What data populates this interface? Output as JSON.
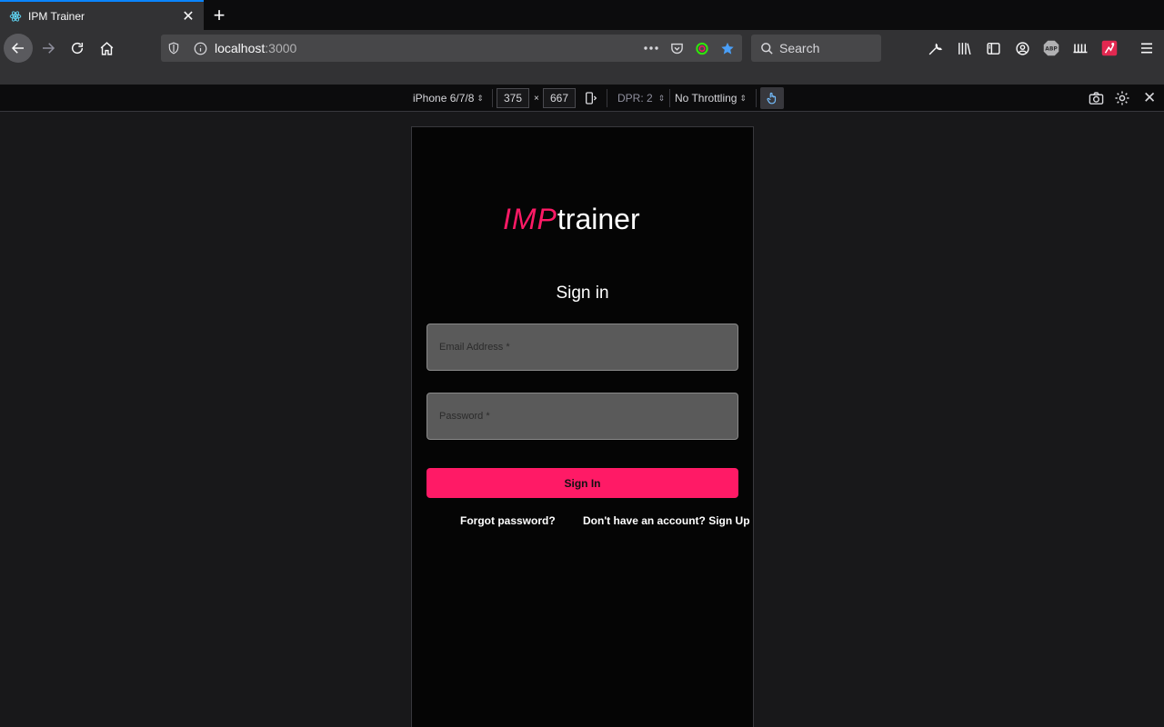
{
  "tab": {
    "title": "IPM Trainer"
  },
  "navbar": {
    "url_host": "localhost",
    "url_port": ":3000",
    "search_placeholder": "Search"
  },
  "rdm": {
    "device": "iPhone 6/7/8",
    "width": "375",
    "times": "×",
    "height": "667",
    "dpr": "DPR: 2",
    "throttling": "No Throttling"
  },
  "app": {
    "logo_part1": "IMP",
    "logo_part2": "trainer",
    "title": "Sign in",
    "email_placeholder": "Email Address *",
    "password_placeholder": "Password *",
    "signin_label": "Sign In",
    "forgot_label": "Forgot password?",
    "signup_label": "Don't have an account? Sign Up"
  },
  "colors": {
    "accent": "#ff1a66",
    "browser_highlight": "#0a84ff"
  },
  "icons": [
    "react-icon",
    "close-icon",
    "plus-icon",
    "back-icon",
    "forward-icon",
    "reload-icon",
    "home-icon",
    "shield-icon",
    "info-icon",
    "more-icon",
    "pocket-icon",
    "extension-icon",
    "bookmark-star-icon",
    "search-icon",
    "wrench-icon",
    "library-icon",
    "sidebar-icon",
    "account-icon",
    "abp-icon",
    "ruler-icon",
    "game-icon",
    "menu-icon",
    "rotate-icon",
    "touch-icon",
    "camera-icon",
    "settings-icon"
  ]
}
